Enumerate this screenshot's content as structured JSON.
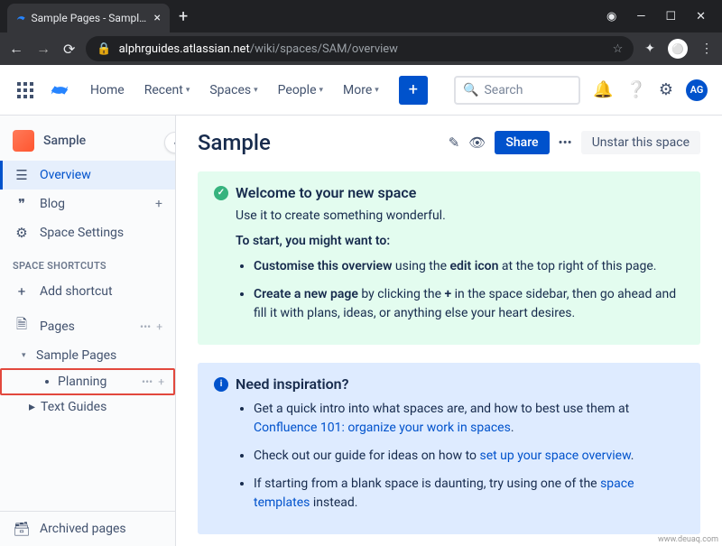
{
  "browser": {
    "tab_title": "Sample Pages - Sample - Conflue",
    "url_host": "alphrguides.atlassian.net",
    "url_path": "/wiki/spaces/SAM/overview"
  },
  "header": {
    "menu": {
      "home": "Home",
      "recent": "Recent",
      "spaces": "Spaces",
      "people": "People",
      "more": "More"
    },
    "search_placeholder": "Search",
    "avatar": "AG"
  },
  "sidebar": {
    "space_name": "Sample",
    "nav": {
      "overview": "Overview",
      "blog": "Blog",
      "settings": "Space Settings"
    },
    "shortcuts_label": "SPACE SHORTCUTS",
    "add_shortcut": "Add shortcut",
    "pages_label": "Pages",
    "tree": {
      "sample_pages": "Sample Pages",
      "planning": "Planning",
      "text_guides": "Text Guides"
    },
    "archived": "Archived pages"
  },
  "page": {
    "title": "Sample",
    "share": "Share",
    "unstar": "Unstar this space",
    "welcome": {
      "title": "Welcome to your new space",
      "sub": "Use it to create something wonderful.",
      "start": "To start, you might want to:",
      "b1a": "Customise this overview",
      "b1b": " using the ",
      "b1c": "edit icon",
      "b1d": " at the top right of this page.",
      "b2a": "Create a new page",
      "b2b": " by clicking the ",
      "b2c": "+",
      "b2d": " in the space sidebar, then go ahead and fill it with plans, ideas, or anything else your heart desires."
    },
    "inspiration": {
      "title": "Need inspiration?",
      "l1a": "Get a quick intro into what spaces are, and how to best use them at ",
      "l1b": "Confluence 101: organize your work in spaces",
      "l1c": ".",
      "l2a": "Check out our guide for ideas on how to ",
      "l2b": "set up your space overview",
      "l2c": ".",
      "l3a": "If starting from a blank space is daunting, try using one of the ",
      "l3b": "space templates",
      "l3c": " instead."
    }
  },
  "watermark": "www.deuaq.com"
}
